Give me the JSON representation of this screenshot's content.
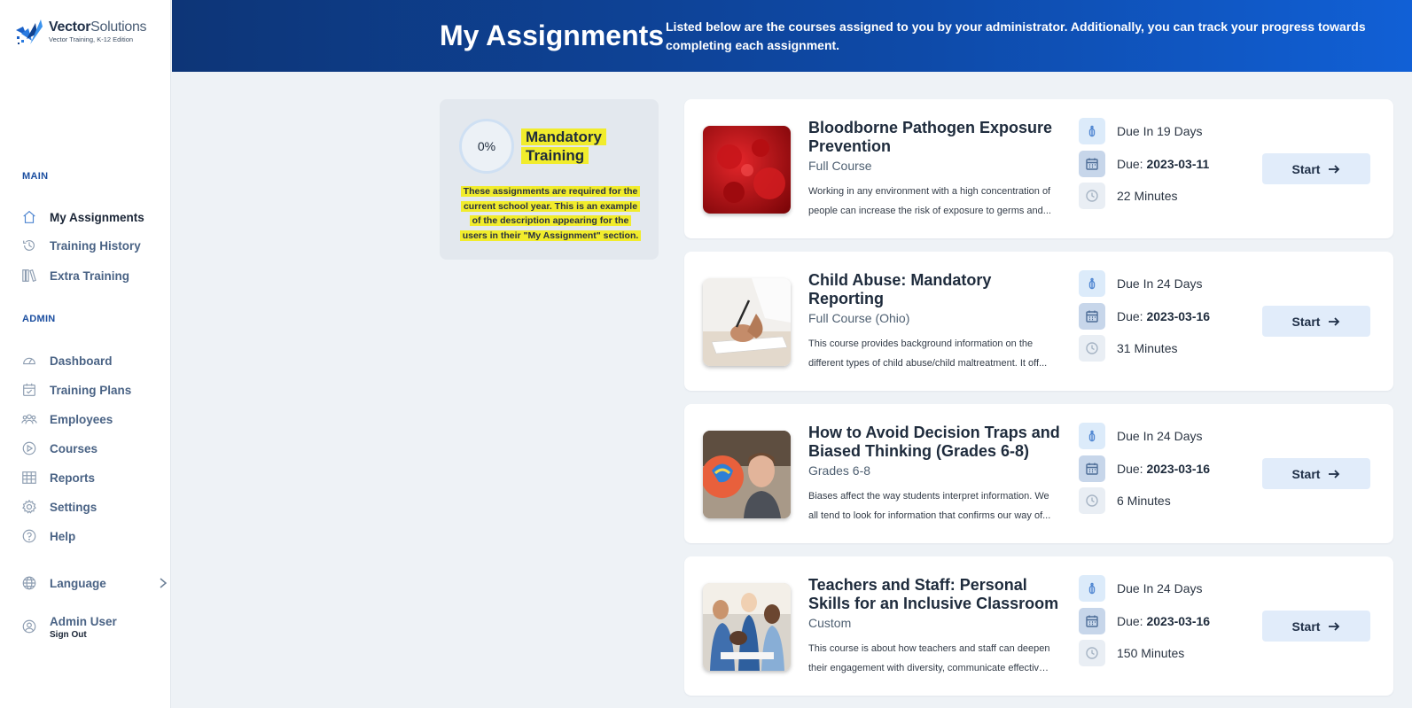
{
  "brand": {
    "name_bold": "Vector",
    "name_light": "Solutions",
    "edition": "Vector Training, K-12 Edition"
  },
  "sidebar": {
    "main_title": "MAIN",
    "main_items": [
      {
        "label": "My Assignments",
        "icon": "home-icon"
      },
      {
        "label": "Training History",
        "icon": "history-icon"
      },
      {
        "label": "Extra Training",
        "icon": "books-icon"
      }
    ],
    "admin_title": "ADMIN",
    "admin_items": [
      {
        "label": "Dashboard",
        "icon": "gauge-icon"
      },
      {
        "label": "Training Plans",
        "icon": "calendar-check-icon"
      },
      {
        "label": "Employees",
        "icon": "people-icon"
      },
      {
        "label": "Courses",
        "icon": "play-circle-icon"
      },
      {
        "label": "Reports",
        "icon": "table-icon"
      },
      {
        "label": "Settings",
        "icon": "gear-icon"
      },
      {
        "label": "Help",
        "icon": "question-icon"
      }
    ],
    "language_label": "Language",
    "user_name": "Admin User",
    "sign_out": "Sign Out"
  },
  "header": {
    "title": "My Assignments",
    "description": "Listed below are the courses assigned to you by your administrator. Additionally, you can track your progress towards completing each assignment."
  },
  "summary": {
    "progress": "0%",
    "title_line1": "Mandatory",
    "title_line2": "Training",
    "desc_lines": [
      "These assignments are required for the",
      "current school year. This is an example",
      "of the description appearing for the",
      "users in their \"My Assignment\" section."
    ]
  },
  "courses": [
    {
      "title": "Bloodborne Pathogen Exposure Prevention",
      "type": "Full Course",
      "desc_line1": "Working in any environment with a high concentration of",
      "desc_line2": "people can increase the risk of exposure to germs and...",
      "due_in": "Due In 19 Days",
      "due_label": "Due:",
      "due_date": "2023-03-11",
      "duration": "22 Minutes",
      "start": "Start"
    },
    {
      "title": "Child Abuse: Mandatory Reporting",
      "type": "Full Course (Ohio)",
      "desc_line1": "This course provides background information on the",
      "desc_line2": "different types of child abuse/child maltreatment. It off...",
      "due_in": "Due In 24 Days",
      "due_label": "Due:",
      "due_date": "2023-03-16",
      "duration": "31 Minutes",
      "start": "Start"
    },
    {
      "title": "How to Avoid Decision Traps and Biased Thinking (Grades 6-8)",
      "type": "Grades 6-8",
      "desc_line1": "Biases affect the way students interpret information. We",
      "desc_line2": "all tend to look for information that confirms our way of...",
      "due_in": "Due In 24 Days",
      "due_label": "Due:",
      "due_date": "2023-03-16",
      "duration": "6 Minutes",
      "start": "Start"
    },
    {
      "title": "Teachers and Staff: Personal Skills for an Inclusive Classroom",
      "type": "Custom",
      "desc_line1": "This course is about how teachers and staff can deepen",
      "desc_line2": "their engagement with diversity, communicate effectivel...",
      "due_in": "Due In 24 Days",
      "due_label": "Due:",
      "due_date": "2023-03-16",
      "duration": "150 Minutes",
      "start": "Start"
    }
  ],
  "colors": {
    "header_start": "#0d3577",
    "header_end": "#1160d6",
    "accent": "#1c4fa0",
    "highlight": "#f1ec2c",
    "start_button_bg": "#e1ecfa"
  }
}
